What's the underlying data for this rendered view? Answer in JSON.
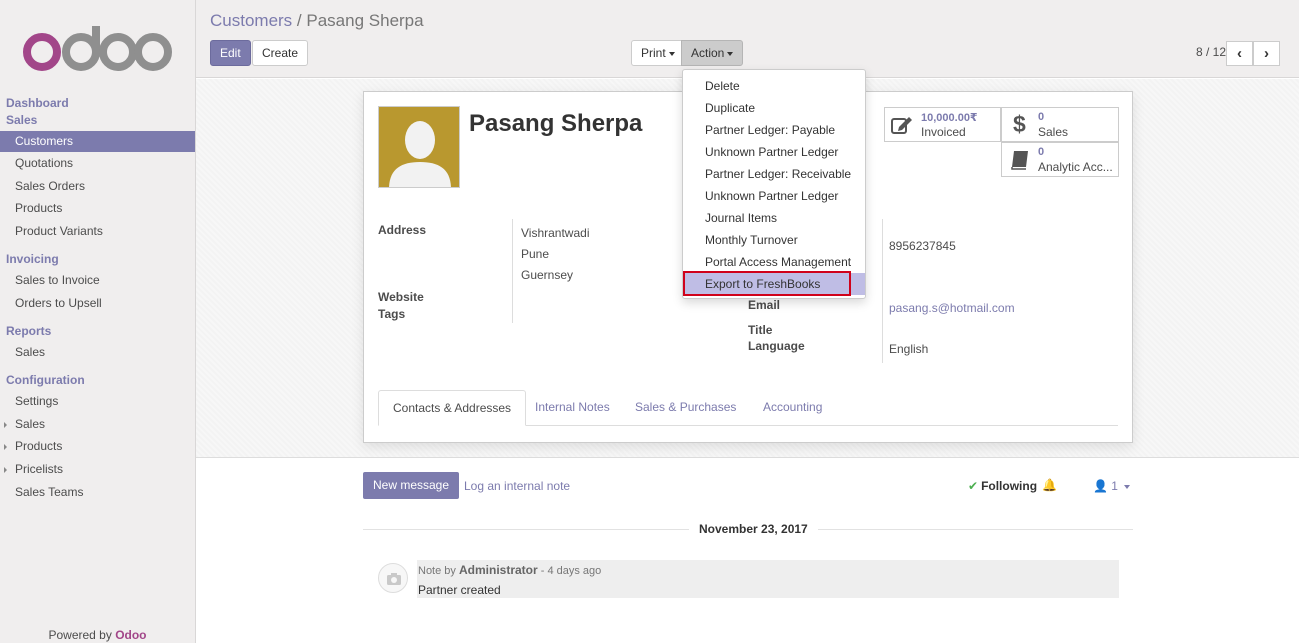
{
  "sidebar": {
    "brand": "odoo",
    "sections": [
      {
        "title": "Dashboard"
      },
      {
        "title": "Sales"
      },
      {
        "title": "Invoicing"
      },
      {
        "title": "Reports"
      },
      {
        "title": "Configuration"
      }
    ],
    "items": {
      "customers": "Customers",
      "quotations": "Quotations",
      "sales_orders": "Sales Orders",
      "products": "Products",
      "product_variants": "Product Variants",
      "sales_to_invoice": "Sales to Invoice",
      "orders_to_upsell": "Orders to Upsell",
      "report_sales": "Sales",
      "settings": "Settings",
      "cfg_sales": "Sales",
      "cfg_products": "Products",
      "pricelists": "Pricelists",
      "sales_teams": "Sales Teams"
    },
    "powered_by": "Powered by",
    "powered_brand": "Odoo",
    "accent": "#7c7bad",
    "brand_color": "#a24689"
  },
  "breadcrumb": {
    "parent": "Customers",
    "separator": "/",
    "current": "Pasang Sherpa"
  },
  "toolbar": {
    "edit": "Edit",
    "create": "Create",
    "print": "Print",
    "action": "Action"
  },
  "pager": {
    "value": "8 / 12"
  },
  "action_menu": {
    "items": [
      "Delete",
      "Duplicate",
      "Partner Ledger: Payable",
      "Unknown Partner Ledger",
      "Partner Ledger: Receivable",
      "Unknown Partner Ledger",
      "Journal Items",
      "Monthly Turnover",
      "Portal Access Management",
      "Export to FreshBooks"
    ],
    "highlighted": "Export to FreshBooks"
  },
  "partner": {
    "name": "Pasang Sherpa",
    "labels": {
      "address": "Address",
      "website": "Website",
      "tags": "Tags",
      "email": "Email",
      "title": "Title",
      "language": "Language"
    },
    "address_lines": [
      "Vishrantwadi",
      "Pune",
      "Guernsey"
    ],
    "phone": "8956237845",
    "email": "pasang.s@hotmail.com",
    "language": "English"
  },
  "stats": {
    "invoiced_value": "10,000.00₹",
    "invoiced_label": "Invoiced",
    "sales_value": "0",
    "sales_label": "Sales",
    "analytic_value": "0",
    "analytic_label": "Analytic Acc..."
  },
  "tabs": [
    "Contacts & Addresses",
    "Internal Notes",
    "Sales & Purchases",
    "Accounting"
  ],
  "chatter": {
    "new_message": "New message",
    "log_note": "Log an internal note",
    "following": "Following",
    "followers": "1",
    "date": "November 23, 2017",
    "message": {
      "prefix": "Note by",
      "author": "Administrator",
      "time": "- 4 days ago",
      "body": "Partner created"
    }
  }
}
